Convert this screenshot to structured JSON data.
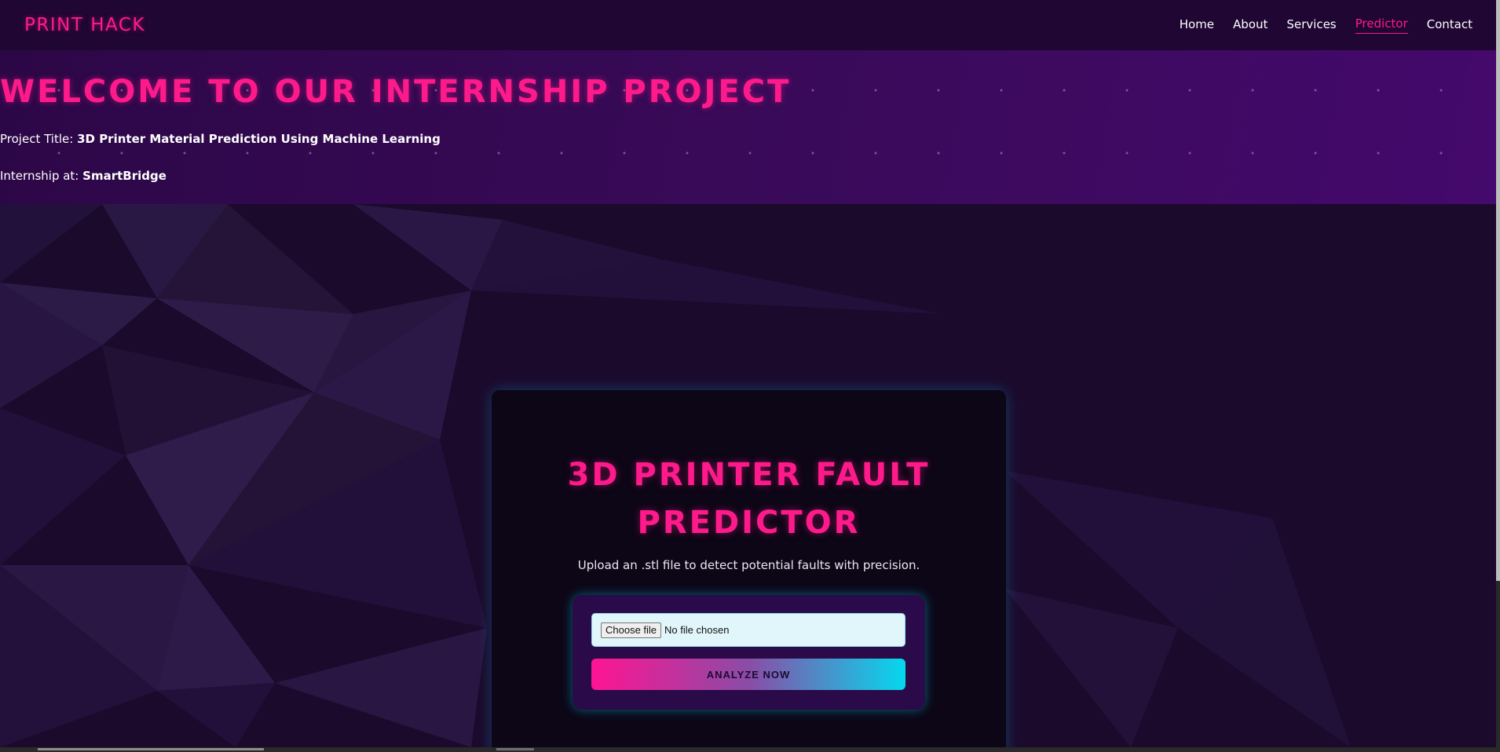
{
  "nav": {
    "brand": "PRINT HACK",
    "links": [
      {
        "label": "Home",
        "active": false
      },
      {
        "label": "About",
        "active": false
      },
      {
        "label": "Services",
        "active": false
      },
      {
        "label": "Predictor",
        "active": true
      },
      {
        "label": "Contact",
        "active": false
      }
    ]
  },
  "hero": {
    "title": "WELCOME TO OUR INTERNSHIP PROJECT",
    "project_label": "Project Title:",
    "project_value": "3D Printer Material Prediction Using Machine Learning",
    "internship_label": "Internship at:",
    "internship_value": "SmartBridge"
  },
  "card": {
    "title_line1": "3D PRINTER FAULT",
    "title_line2": "PREDICTOR",
    "subtitle": "Upload an .stl file to detect potential faults with precision.",
    "file_button": "Choose file",
    "file_status": "No file chosen",
    "submit_label": "ANALYZE NOW"
  },
  "colors": {
    "accent_pink": "#ff1a8c",
    "accent_cyan": "#05d8ee",
    "nav_bg": "#1f0633",
    "page_bg": "#190829"
  }
}
